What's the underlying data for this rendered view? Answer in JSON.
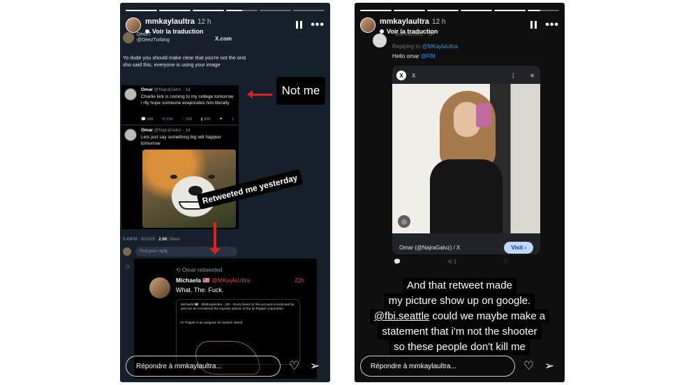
{
  "story_left": {
    "username": "mmkaylaultra",
    "time": "12 h",
    "translate_label": "Voir la traduction",
    "progress": [
      1,
      1,
      1,
      0.5,
      0,
      0
    ],
    "reply_placeholder": "Répondre à mmkaylaultra...",
    "screenshot": {
      "author_name": "DeezT",
      "author_handle": "@DeezTurbing",
      "site": "X.com",
      "body": "Yo dude you should make clear that you're not the ond sho said this, everyone is using your image",
      "tweet1": {
        "name": "Omar",
        "handle": "@NajraGalvz · 1d",
        "text": "Charlie kirk is coming to my college tomorrow i rlly hope someone evaporates him literally",
        "stats": [
          "348",
          "234",
          "158",
          "90K",
          "",
          ""
        ]
      },
      "tweet2": {
        "name": "Omar",
        "handle": "@NajraGalvz · 1d",
        "text": "Lets just say something big will happen tomorrow"
      },
      "meta_time": "5:43PM · 9/10/25 · ",
      "meta_views": "2.6K",
      "meta_views_label": " Views",
      "post_reply": "Post your reply",
      "retweet": {
        "label": "Omar retweeted",
        "name": "Michaela 🇺🇸",
        "handle": "@MKaylaUltra",
        "time": "22h",
        "text": "What. The. Fuck.",
        "quote1": "Michaela 🇺🇸 · @MKaylaUltra · 22h · Every tweet on this account is endorsed by and can be considered the express opinion of the Dr Pepper corporation",
        "quote2": "Dr Pepper is an anagram for Epstein Island"
      }
    },
    "sticker_not_me": "Not me",
    "sticker_retweeted": "Retweeted me yesterday"
  },
  "story_right": {
    "username": "mmkaylaultra",
    "time": "12 h",
    "translate_label": "Voir la traduction",
    "progress": [
      1,
      1,
      1,
      1,
      1,
      0.4
    ],
    "reply_placeholder": "Répondre à mmkaylaultra...",
    "screenshot": {
      "header": "Gormonted · 3h",
      "replying_prefix": "Replying to ",
      "replying_to": "@MKaylaUltra",
      "hello_prefix": "Hello omar ",
      "hello_mention": "@FBI",
      "card_site": "X",
      "card_footer": "Omar (@NajraGalvz) / X",
      "visit_label": "Visit ›",
      "stats": [
        "",
        "1",
        ""
      ]
    },
    "caption": [
      "And that retweet made",
      "my picture show up on google.",
      "could we maybe make a",
      "statement that i'm not the shooter",
      "so these people don't kill me"
    ],
    "caption_mention": "@fbi.seattle"
  }
}
